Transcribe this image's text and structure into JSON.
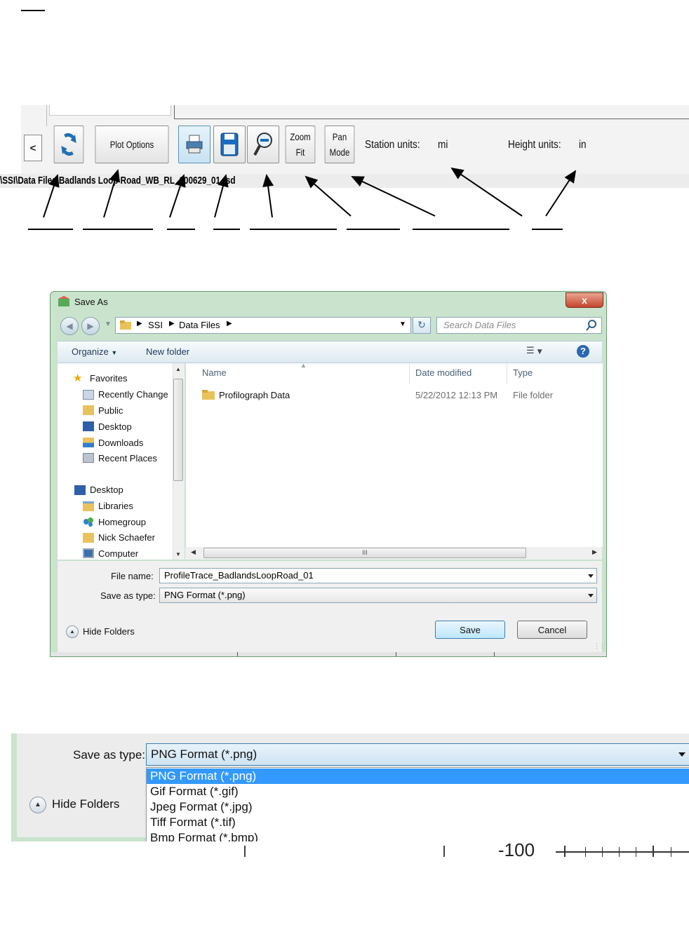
{
  "toolbar": {
    "back_label": "<",
    "plot_options_label": "Plot Options",
    "zoom_fit_line1": "Zoom",
    "zoom_fit_line2": "Fit",
    "pan_mode_line1": "Pan",
    "pan_mode_line2": "Mode",
    "station_units_label": "Station units:",
    "station_units_value": "mi",
    "height_units_label": "Height units:",
    "height_units_value": "in",
    "file_path": "\\SSI\\Data Files\\Badlands Loop Road_WB_RL_100629_01.rsd",
    "icons": [
      "refresh-icon",
      "printer-icon",
      "save-disk-icon",
      "zoom-magnifier-icon"
    ]
  },
  "dialog": {
    "title": "Save As",
    "close_label": "x",
    "breadcrumb": [
      "SSI",
      "Data Files"
    ],
    "search_placeholder": "Search Data Files",
    "organize_label": "Organize",
    "new_folder_label": "New folder",
    "nav": {
      "favorites_label": "Favorites",
      "favorites": [
        "Recently Change",
        "Public",
        "Desktop",
        "Downloads",
        "Recent Places"
      ],
      "desktop_label": "Desktop",
      "tree": [
        "Libraries",
        "Homegroup",
        "Nick Schaefer",
        "Computer"
      ]
    },
    "columns": [
      "Name",
      "Date modified",
      "Type"
    ],
    "files": [
      {
        "name": "Profilograph Data",
        "date": "5/22/2012 12:13 PM",
        "type": "File folder"
      }
    ],
    "hscroll_grip": "III",
    "file_name_label": "File name:",
    "file_name_value": "ProfileTrace_BadlandsLoopRoad_01",
    "save_type_label": "Save as type:",
    "save_type_value": "PNG Format (*.png)",
    "hide_folders_label": "Hide Folders",
    "save_label": "Save",
    "cancel_label": "Cancel"
  },
  "dropdown_view": {
    "save_type_label": "Save as type:",
    "selected": "PNG Format (*.png)",
    "options": [
      "PNG Format (*.png)",
      "Gif Format (*.gif)",
      "Jpeg Format (*.jpg)",
      "Tiff Format (*.tif)",
      "Bmp Format (*.bmp)"
    ],
    "hide_folders_label": "Hide Folders",
    "axis_fragment": "-100"
  },
  "colors": {
    "selection": "#3399ff",
    "dialog_frame": "#c9e3cc",
    "close_button": "#c4472d"
  }
}
